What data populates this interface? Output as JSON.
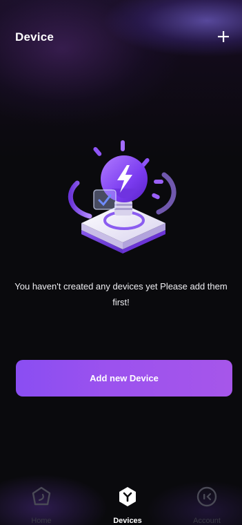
{
  "header": {
    "title": "Device",
    "add_icon": "plus-icon"
  },
  "empty_state": {
    "illustration": "smart-bulb-illustration",
    "message": "You haven't created any devices yet Please add them first!"
  },
  "actions": {
    "add_device_label": "Add new Device"
  },
  "tabbar": {
    "tabs": [
      {
        "label": "Home",
        "icon": "home-icon",
        "active": false
      },
      {
        "label": "Devices",
        "icon": "devices-icon",
        "active": true
      },
      {
        "label": "Account",
        "icon": "account-icon",
        "active": false
      }
    ]
  },
  "colors": {
    "background": "#0a0a0d",
    "accent": "#9c52ee",
    "text": "#ffffff",
    "inactive_tab": "#3a3a44"
  }
}
